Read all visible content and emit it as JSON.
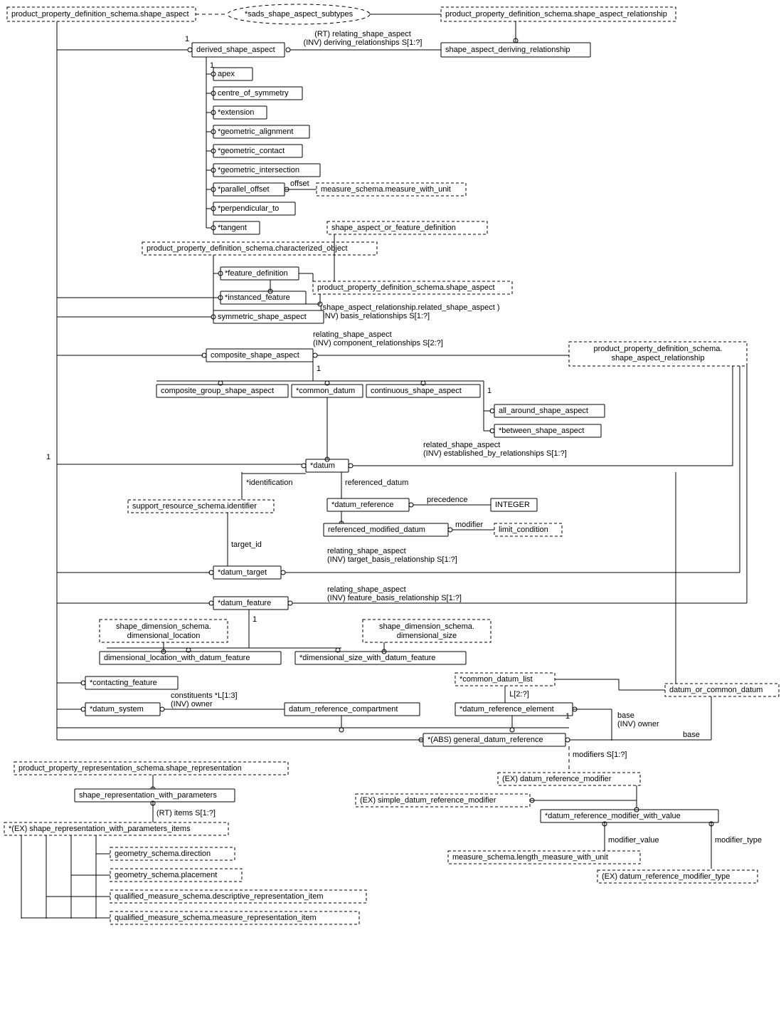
{
  "tl_shape_aspect": "product_property_definition_schema.shape_aspect",
  "tr_sar": "product_property_definition_schema.shape_aspect_relationship",
  "sads": "*sads_shape_aspect_subtypes",
  "derived": "derived_shape_aspect",
  "sadr": "shape_aspect_deriving_relationship",
  "rt_relating": "(RT) relating_shape_aspect",
  "inv_deriving": "(INV) deriving_relationships S[1:?]",
  "apex": "apex",
  "cos": "centre_of_symmetry",
  "ext": "*extension",
  "geoal": "*geometric_alignment",
  "geoco": "*geometric_contact",
  "geoin": "*geometric_intersection",
  "paroff": "*parallel_offset",
  "offset": "offset",
  "mwu": "measure_schema.measure_with_unit",
  "perp": "*perpendicular_to",
  "tan": "*tangent",
  "saofd": "shape_aspect_or_feature_definition",
  "charobj": "product_property_definition_schema.characterized_object",
  "featdef": "*feature_definition",
  "shapeasp2": "product_property_definition_schema.shape_aspect",
  "instfeat": "*instanced_feature",
  "sar_rel": "(shape_aspect_relationship.related_shape_aspect )",
  "inv_basis": "(INV) basis_relationships S[1:?]",
  "sym_sa": "symmetric_shape_aspect",
  "relating_sa": "relating_shape_aspect",
  "inv_comp": "(INV) component_relationships S[2:?]",
  "comp_sa": "composite_shape_aspect",
  "ppds_sar2_1": "product_property_definition_schema.",
  "ppds_sar2_2": "shape_aspect_relationship",
  "cgsa": "composite_group_shape_aspect",
  "cdat": "*common_datum",
  "consa": "continuous_shape_aspect",
  "allar": "all_around_shape_aspect",
  "betw": "*between_shape_aspect",
  "rel_sa2": "related_shape_aspect",
  "inv_est": "(INV) established_by_relationships S[1:?]",
  "datum": "*datum",
  "ident": "*identification",
  "refd": "referenced_datum",
  "srsid": "support_resource_schema.identifier",
  "dref": "*datum_reference",
  "prec": "precedence",
  "int": "INTEGER",
  "rmd": "referenced_modified_datum",
  "mod": "modifier",
  "limcond": "limit_condition",
  "tgt_id": "target_id",
  "dtgt": "*datum_target",
  "rel_sa3": "relating_shape_aspect",
  "inv_tbr": "(INV) target_basis_relationship S[1:?]",
  "dfeat": "*datum_feature",
  "rel_sa4": "relating_shape_aspect",
  "inv_fbr": "(INV) feature_basis_relationship S[1:?]",
  "sds_dl_1": "shape_dimension_schema.",
  "sds_dl_2": "dimensional_location",
  "sds_ds_1": "shape_dimension_schema.",
  "sds_ds_2": "dimensional_size",
  "dlwdf": "dimensional_location_with_datum_feature",
  "dswdf": "*dimensional_size_with_datum_feature",
  "cfeat": "*contacting_feature",
  "cdlist": "*common_datum_list",
  "docd": "datum_or_common_datum",
  "l2": "L[2:?]",
  "dsys": "*datum_system",
  "cons": "constituents *L[1:3]",
  "inv_owner": "(INV) owner",
  "drc": "datum_reference_compartment",
  "dre": "*datum_reference_element",
  "base": "base",
  "inv_owner2": "(INV) owner",
  "base2": "base",
  "gdr": "*(ABS) general_datum_reference",
  "modS": "modifiers S[1:?]",
  "drm": "(EX) datum_reference_modifier",
  "sdrm": "(EX) simple_datum_reference_modifier",
  "drmwv": "*datum_reference_modifier_with_value",
  "mval": "modifier_value",
  "mtype": "modifier_type",
  "lmwu": "measure_schema.length_measure_with_unit",
  "drmt": "(EX) datum_reference_modifier_type",
  "pprssr": "product_property_representation_schema.shape_representation",
  "srwp": "shape_representation_with_parameters",
  "rt_items": "(RT) items S[1:?]",
  "srwpi": "*(EX) shape_representation_with_parameters_items",
  "gdir": "geometry_schema.direction",
  "gplace": "geometry_schema.placement",
  "qdri": "qualified_measure_schema.descriptive_representation_item",
  "qmri": "qualified_measure_schema.measure_representation_item",
  "one": "1"
}
